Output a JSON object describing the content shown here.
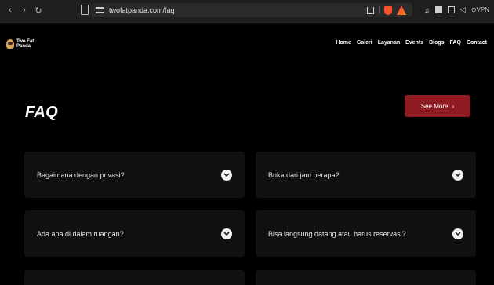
{
  "browser": {
    "url": "twofatpanda.com/faq",
    "vpn_label": "VPN"
  },
  "site": {
    "logo_line1": "Two Fat",
    "logo_line2": "Panda",
    "nav": [
      "Home",
      "Galeri",
      "Layanan",
      "Events",
      "Blogs",
      "FAQ",
      "Contact"
    ]
  },
  "faq": {
    "title": "FAQ",
    "see_more_label": "See More",
    "questions": [
      "Bagaimana dengan privasi?",
      "Buka dari jam berapa?",
      "Ada apa di dalam ruangan?",
      "Bisa langsung datang atau harus reservasi?"
    ]
  },
  "colors": {
    "accent": "#8e1b22",
    "card_bg": "#111111",
    "page_bg": "#000000"
  }
}
